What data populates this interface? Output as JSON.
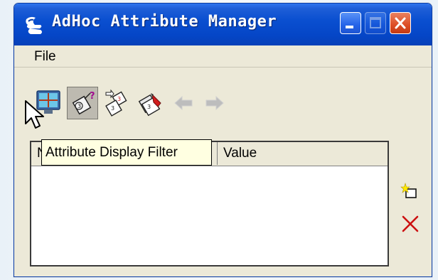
{
  "window": {
    "title": "AdHoc Attribute Manager"
  },
  "menu": {
    "items": [
      {
        "label": "File"
      }
    ]
  },
  "toolbar": {
    "buttons": [
      {
        "icon": "attribute-display-filter-icon",
        "pressed": false
      },
      {
        "icon": "attribute-query-icon",
        "pressed": true
      },
      {
        "icon": "attribute-pick-icon",
        "pressed": false
      },
      {
        "icon": "attribute-remove-icon",
        "pressed": false
      },
      {
        "icon": "arrow-left-icon",
        "enabled": false
      },
      {
        "icon": "arrow-right-icon",
        "enabled": false
      }
    ]
  },
  "tooltip": {
    "text": "Attribute Display Filter"
  },
  "list": {
    "columns": [
      {
        "label": "N"
      },
      {
        "label": "Value"
      }
    ],
    "rows": []
  },
  "side_actions": [
    {
      "icon": "new-item-icon"
    },
    {
      "icon": "delete-icon"
    }
  ],
  "colors": {
    "titlebar": "#0546c7",
    "window_bg": "#ece9d8",
    "tooltip_bg": "#ffffe1",
    "delete_red": "#cc1111"
  }
}
